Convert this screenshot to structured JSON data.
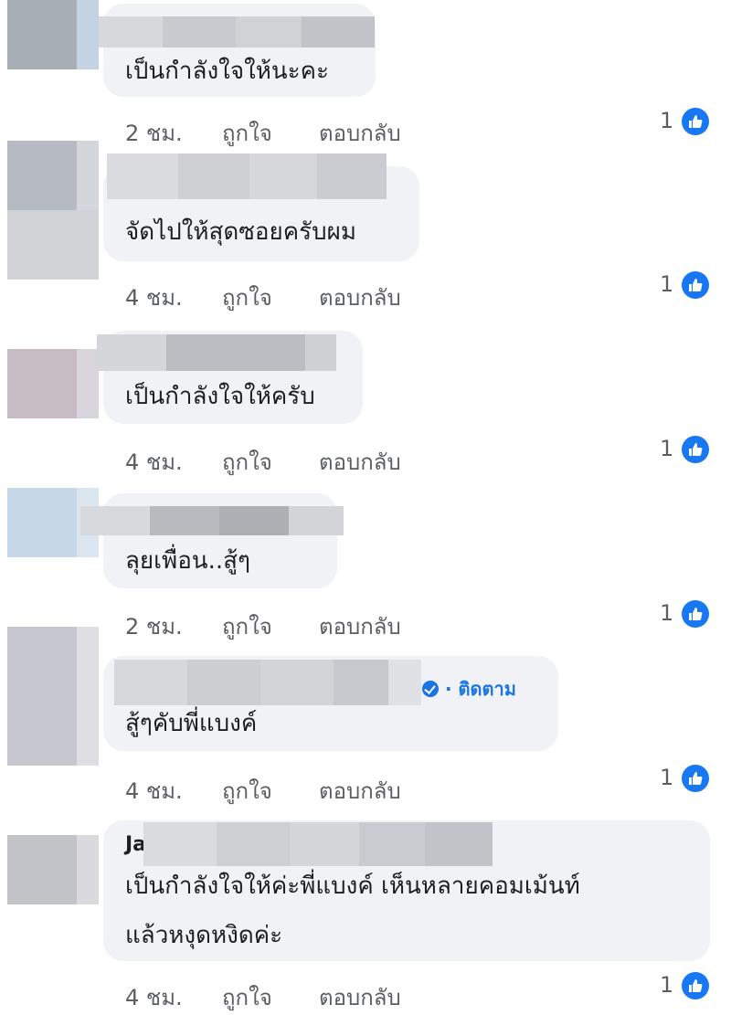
{
  "comments": [
    {
      "text": "เป็นกำลังใจให้นะคะ",
      "time": "2 ชม.",
      "like": "ถูกใจ",
      "reply": "ตอบกลับ",
      "like_count": "1"
    },
    {
      "text": "จัดไปให้สุดซอยครับผม",
      "time": "4 ชม.",
      "like": "ถูกใจ",
      "reply": "ตอบกลับ",
      "like_count": "1"
    },
    {
      "text": "เป็นกำลังใจให้ครับ",
      "time": "4 ชม.",
      "like": "ถูกใจ",
      "reply": "ตอบกลับ",
      "like_count": "1"
    },
    {
      "text": "ลุยเพื่อน..สู้ๆ",
      "time": "2 ชม.",
      "like": "ถูกใจ",
      "reply": "ตอบกลับ",
      "like_count": "1"
    },
    {
      "text": "สู้ๆคับพี่แบงค์",
      "follow": "· ติดตาม",
      "time": "4 ชม.",
      "like": "ถูกใจ",
      "reply": "ตอบกลับ",
      "like_count": "1"
    },
    {
      "name_prefix": "Ja",
      "text_line1": "เป็นกำลังใจให้ค่ะพี่แบงค์ เห็นหลายคอมเม้นท์",
      "text_line2": "แล้วหงุดหงิดค่ะ",
      "time": "4 ชม.",
      "like": "ถูกใจ",
      "reply": "ตอบกลับ",
      "like_count": "1"
    }
  ],
  "colors": {
    "bubble": "#f0f2f5",
    "like_blue": "#1877f2",
    "meta_text": "#5b5e63",
    "follow_blue": "#1b74e4"
  },
  "icons": {
    "like": "thumbs-up-icon",
    "verified": "verified-badge-icon"
  }
}
